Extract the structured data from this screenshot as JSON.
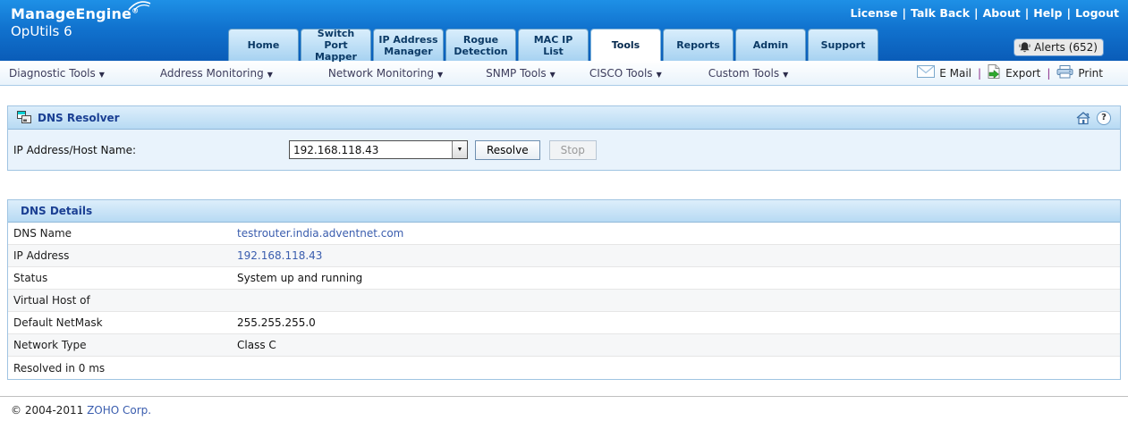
{
  "header": {
    "logo": {
      "brand": "ManageEngine",
      "reg": "®",
      "product": "OpUtils 6"
    },
    "top_links": [
      "License",
      "Talk Back",
      "About",
      "Help",
      "Logout"
    ],
    "link_separator": "|",
    "tabs": [
      {
        "label": "Home",
        "active": false
      },
      {
        "label": "Switch Port Mapper",
        "active": false
      },
      {
        "label": "IP Address Manager",
        "active": false
      },
      {
        "label": "Rogue Detection",
        "active": false
      },
      {
        "label": "MAC IP List",
        "active": false
      },
      {
        "label": "Tools",
        "active": true
      },
      {
        "label": "Reports",
        "active": false
      },
      {
        "label": "Admin",
        "active": false
      },
      {
        "label": "Support",
        "active": false
      }
    ],
    "alerts_label": "Alerts (652)",
    "alerts_icon": "bell-icon"
  },
  "menubar": {
    "dropdown_arrow": "▼",
    "menus": [
      "Diagnostic Tools",
      "Address Monitoring",
      "Network Monitoring",
      "SNMP Tools",
      "CISCO Tools",
      "Custom Tools"
    ],
    "action_separator": "|",
    "actions": [
      {
        "label": "E Mail",
        "icon": "envelope-icon"
      },
      {
        "label": "Export",
        "icon": "export-icon"
      },
      {
        "label": "Print",
        "icon": "printer-icon"
      }
    ]
  },
  "resolver": {
    "title": "DNS Resolver",
    "ip_label": "IP Address/Host Name:",
    "ip_value": "192.168.118.43",
    "resolve_label": "Resolve",
    "stop_label": "Stop"
  },
  "details": {
    "title": "DNS Details",
    "rows": [
      {
        "label": "DNS Name",
        "value": "testrouter.india.adventnet.com",
        "link": true
      },
      {
        "label": "IP Address",
        "value": "192.168.118.43",
        "link": true
      },
      {
        "label": "Status",
        "value": "System up and running",
        "link": false
      },
      {
        "label": "Virtual Host of",
        "value": "",
        "link": false
      },
      {
        "label": "Default NetMask",
        "value": "255.255.255.0",
        "link": false
      },
      {
        "label": "Network Type",
        "value": "Class C",
        "link": false
      },
      {
        "label": "Resolved in 0 ms",
        "value": "",
        "link": false
      }
    ]
  },
  "footer": {
    "copyright": "© 2004-2011",
    "link": "ZOHO Corp."
  },
  "colors": {
    "header_blue_top": "#1e90e6",
    "header_blue_bottom": "#0a5cb8",
    "tab_text": "#0b3a66",
    "panel_title": "#1a3f93",
    "value_link": "#3a5dae"
  }
}
